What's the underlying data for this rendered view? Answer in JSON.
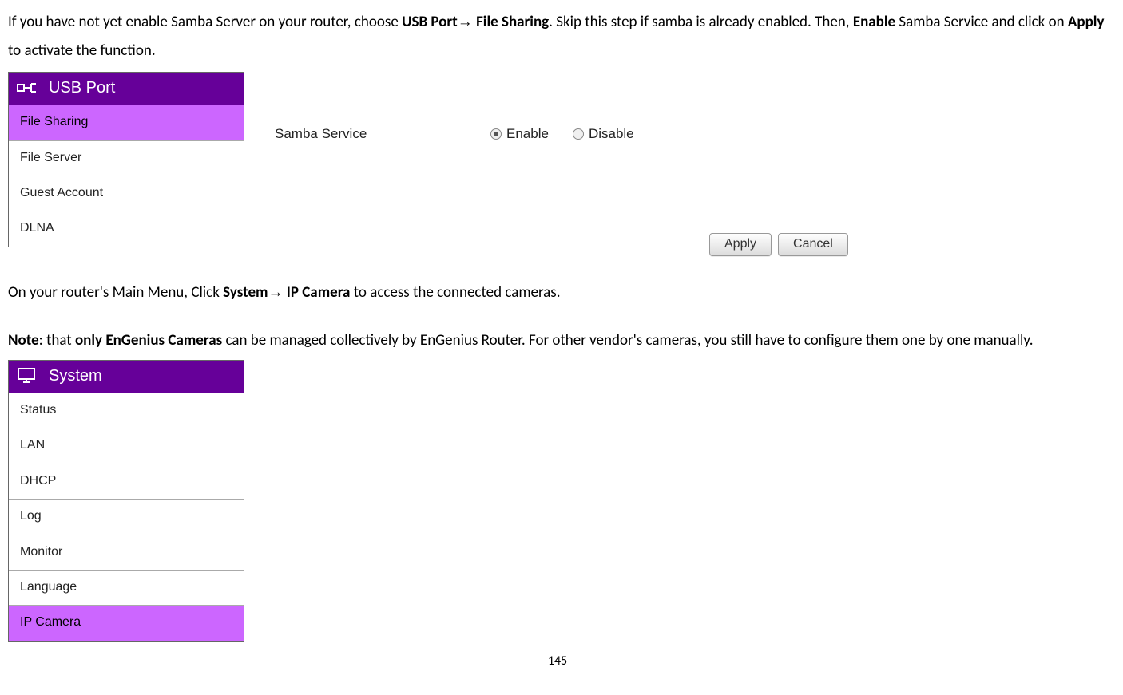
{
  "para1": {
    "t1": "If you have not yet enable Samba Server on your router, choose ",
    "b1": "USB Port",
    "arrow": "→",
    "b2": " File Sharing",
    "t2": ". Skip this step if samba is already enabled. Then, ",
    "b3": "Enable",
    "t3": " Samba Service and click on ",
    "b4": "Apply",
    "t4": " to activate the function."
  },
  "usb_menu": {
    "header": "USB Port",
    "items": [
      "File Sharing",
      "File Server",
      "Guest Account",
      "DLNA"
    ],
    "active_index": 0
  },
  "samba": {
    "label": "Samba Service",
    "enable": "Enable",
    "disable": "Disable",
    "selected": "enable"
  },
  "buttons": {
    "apply": "Apply",
    "cancel": "Cancel"
  },
  "para2": {
    "t1": "On your router's Main Menu, Click ",
    "b1": "System",
    "arrow": "→",
    "b2": " IP Camera",
    "t2": " to access the connected cameras."
  },
  "para3": {
    "n": "Note",
    "t1": ": that ",
    "b1": "only EnGenius Cameras",
    "t2": " can be managed collectively by EnGenius Router. For other vendor's cameras, you still have to configure them one by one manually."
  },
  "system_menu": {
    "header": "System",
    "items": [
      "Status",
      "LAN",
      "DHCP",
      "Log",
      "Monitor",
      "Language",
      "IP Camera"
    ],
    "active_index": 6
  },
  "page_number": "145"
}
